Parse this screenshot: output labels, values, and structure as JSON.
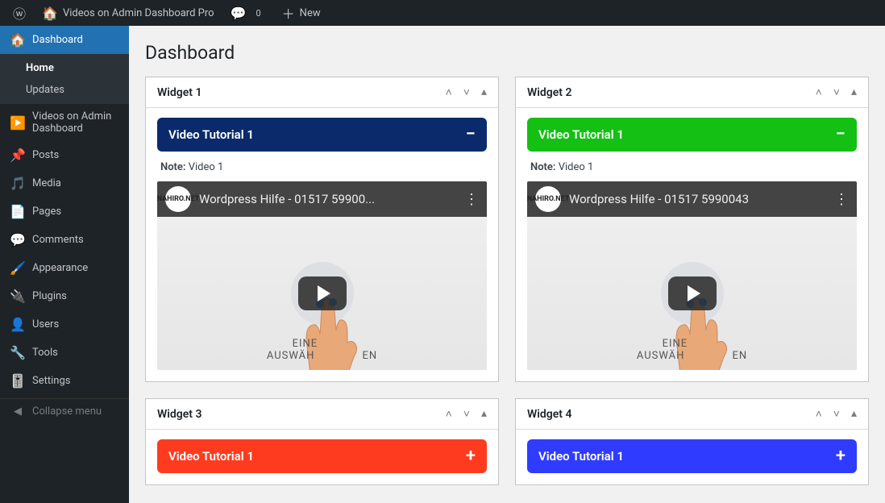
{
  "toolbar": {
    "site_title": "Videos on Admin Dashboard Pro",
    "comments_count": "0",
    "new_label": "New"
  },
  "sidebar": {
    "dashboard": "Dashboard",
    "home": "Home",
    "updates": "Updates",
    "videos_on_admin": "Videos on Admin Dashboard",
    "posts": "Posts",
    "media": "Media",
    "pages": "Pages",
    "comments": "Comments",
    "appearance": "Appearance",
    "plugins": "Plugins",
    "users": "Users",
    "tools": "Tools",
    "settings": "Settings",
    "collapse": "Collapse menu"
  },
  "page": {
    "title": "Dashboard"
  },
  "widgets": [
    {
      "title": "Widget 1",
      "tutorial_label": "Video Tutorial 1",
      "bar_color": "#0b2a6b",
      "expanded": true,
      "note_label": "Note:",
      "note_value": "Video 1",
      "video_title": "Wordpress Hilfe - 01517 59900...",
      "channel": "NAHIRO.NET",
      "stage_line1": "EINE",
      "stage_line2": "AUSWÄH",
      "stage_line3": "EN"
    },
    {
      "title": "Widget 2",
      "tutorial_label": "Video Tutorial 1",
      "bar_color": "#14c014",
      "expanded": true,
      "note_label": "Note:",
      "note_value": "Video 1",
      "video_title": "Wordpress Hilfe - 01517 5990043",
      "channel": "NAHIRO.NET",
      "stage_line1": "EINE",
      "stage_line2": "AUSWÄH",
      "stage_line3": "EN"
    },
    {
      "title": "Widget 3",
      "tutorial_label": "Video Tutorial 1",
      "bar_color": "#ff3b1f",
      "expanded": false
    },
    {
      "title": "Widget 4",
      "tutorial_label": "Video Tutorial 1",
      "bar_color": "#2f3cff",
      "expanded": false
    }
  ]
}
